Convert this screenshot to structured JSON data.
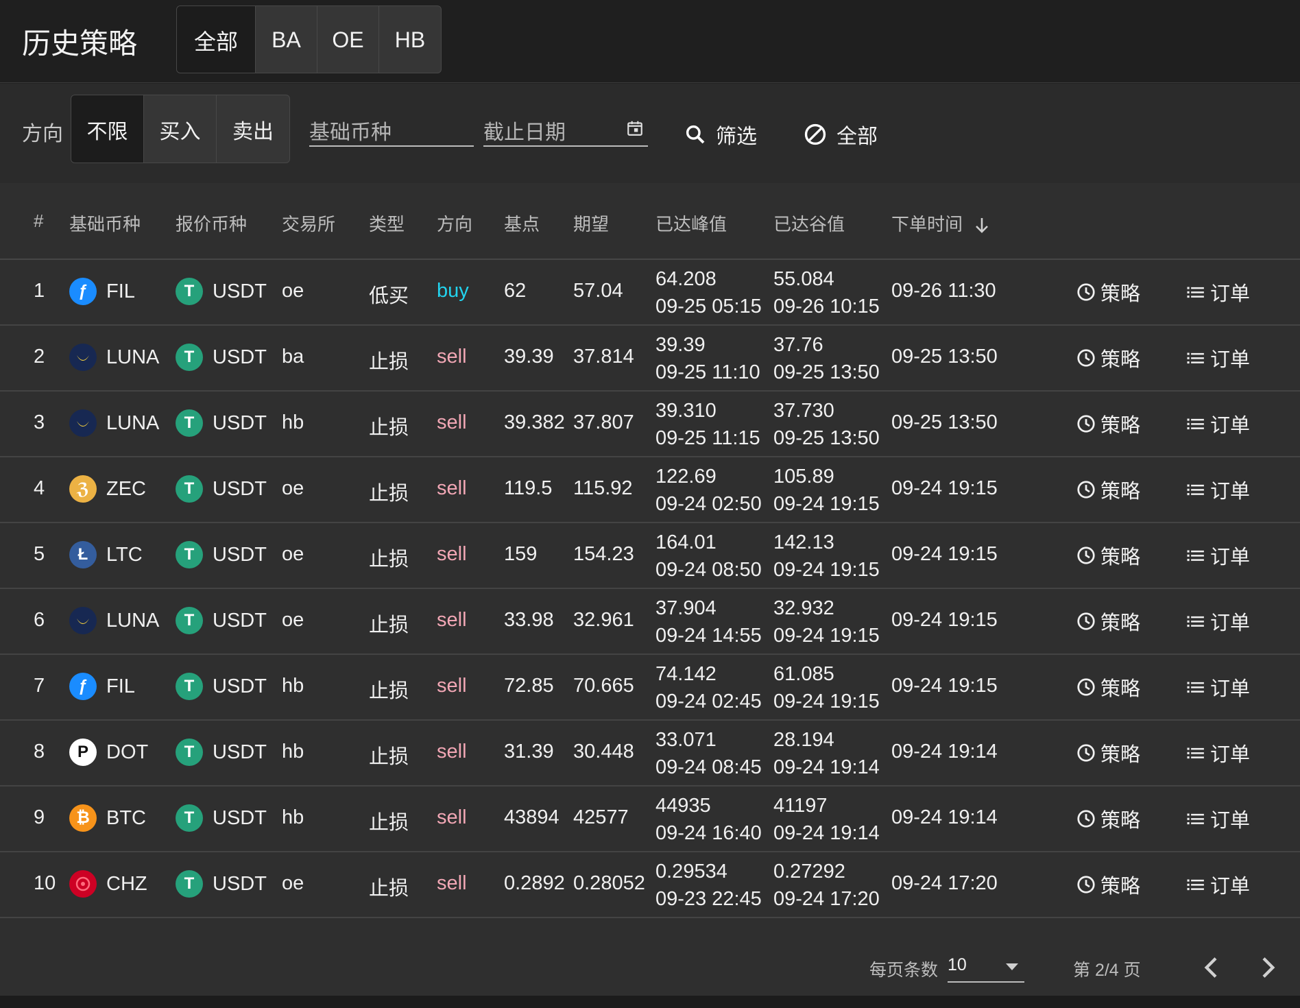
{
  "header": {
    "title": "历史策略",
    "exchange_tabs": [
      "全部",
      "BA",
      "OE",
      "HB"
    ],
    "active_exchange": "全部"
  },
  "filters": {
    "direction_label": "方向",
    "direction_options": [
      "不限",
      "买入",
      "卖出"
    ],
    "active_direction": "不限",
    "base_coin_placeholder": "基础币种",
    "deadline_placeholder": "截止日期",
    "filter_button": "筛选",
    "clear_button": "全部"
  },
  "table": {
    "columns": [
      "#",
      "基础币种",
      "报价币种",
      "交易所",
      "类型",
      "方向",
      "基点",
      "期望",
      "已达峰值",
      "已达谷值",
      "下单时间"
    ],
    "sort_column": "下单时间",
    "sort_direction": "desc",
    "strategy_label": "策略",
    "order_label": "订单",
    "rows": [
      {
        "idx": "1",
        "base": "FIL",
        "quote": "USDT",
        "exchange": "oe",
        "type": "低买",
        "direction": "buy",
        "base_point": "62",
        "expected": "57.04",
        "peak": "64.208",
        "peak_time": "09-25 05:15",
        "trough": "55.084",
        "trough_time": "09-26 10:15",
        "order_time": "09-26 11:30"
      },
      {
        "idx": "2",
        "base": "LUNA",
        "quote": "USDT",
        "exchange": "ba",
        "type": "止损",
        "direction": "sell",
        "base_point": "39.39",
        "expected": "37.814",
        "peak": "39.39",
        "peak_time": "09-25 11:10",
        "trough": "37.76",
        "trough_time": "09-25 13:50",
        "order_time": "09-25 13:50"
      },
      {
        "idx": "3",
        "base": "LUNA",
        "quote": "USDT",
        "exchange": "hb",
        "type": "止损",
        "direction": "sell",
        "base_point": "39.382",
        "expected": "37.807",
        "peak": "39.310",
        "peak_time": "09-25 11:15",
        "trough": "37.730",
        "trough_time": "09-25 13:50",
        "order_time": "09-25 13:50"
      },
      {
        "idx": "4",
        "base": "ZEC",
        "quote": "USDT",
        "exchange": "oe",
        "type": "止损",
        "direction": "sell",
        "base_point": "119.5",
        "expected": "115.92",
        "peak": "122.69",
        "peak_time": "09-24 02:50",
        "trough": "105.89",
        "trough_time": "09-24 19:15",
        "order_time": "09-24 19:15"
      },
      {
        "idx": "5",
        "base": "LTC",
        "quote": "USDT",
        "exchange": "oe",
        "type": "止损",
        "direction": "sell",
        "base_point": "159",
        "expected": "154.23",
        "peak": "164.01",
        "peak_time": "09-24 08:50",
        "trough": "142.13",
        "trough_time": "09-24 19:15",
        "order_time": "09-24 19:15"
      },
      {
        "idx": "6",
        "base": "LUNA",
        "quote": "USDT",
        "exchange": "oe",
        "type": "止损",
        "direction": "sell",
        "base_point": "33.98",
        "expected": "32.961",
        "peak": "37.904",
        "peak_time": "09-24 14:55",
        "trough": "32.932",
        "trough_time": "09-24 19:15",
        "order_time": "09-24 19:15"
      },
      {
        "idx": "7",
        "base": "FIL",
        "quote": "USDT",
        "exchange": "hb",
        "type": "止损",
        "direction": "sell",
        "base_point": "72.85",
        "expected": "70.665",
        "peak": "74.142",
        "peak_time": "09-24 02:45",
        "trough": "61.085",
        "trough_time": "09-24 19:15",
        "order_time": "09-24 19:15"
      },
      {
        "idx": "8",
        "base": "DOT",
        "quote": "USDT",
        "exchange": "hb",
        "type": "止损",
        "direction": "sell",
        "base_point": "31.39",
        "expected": "30.448",
        "peak": "33.071",
        "peak_time": "09-24 08:45",
        "trough": "28.194",
        "trough_time": "09-24 19:14",
        "order_time": "09-24 19:14"
      },
      {
        "idx": "9",
        "base": "BTC",
        "quote": "USDT",
        "exchange": "hb",
        "type": "止损",
        "direction": "sell",
        "base_point": "43894",
        "expected": "42577",
        "peak": "44935",
        "peak_time": "09-24 16:40",
        "trough": "41197",
        "trough_time": "09-24 19:14",
        "order_time": "09-24 19:14"
      },
      {
        "idx": "10",
        "base": "CHZ",
        "quote": "USDT",
        "exchange": "oe",
        "type": "止损",
        "direction": "sell",
        "base_point": "0.2892",
        "expected": "0.28052",
        "peak": "0.29534",
        "peak_time": "09-23 22:45",
        "trough": "0.27292",
        "trough_time": "09-24 17:20",
        "order_time": "09-24 17:20"
      }
    ]
  },
  "coin_icons": {
    "FIL": {
      "icon": "filecoin-icon",
      "glyph": "ƒ",
      "bg": "#1a8cff",
      "fg": "#ffffff"
    },
    "LUNA": {
      "icon": "terra-luna-icon",
      "glyph": "",
      "bg": "#172852",
      "fg": "#ffd83d"
    },
    "ZEC": {
      "icon": "zcash-icon",
      "glyph": "ℨ",
      "bg": "#ecb244",
      "fg": "#ffffff"
    },
    "LTC": {
      "icon": "litecoin-icon",
      "glyph": "Ł",
      "bg": "#345d9d",
      "fg": "#ffffff"
    },
    "DOT": {
      "icon": "polkadot-icon",
      "glyph": "P",
      "bg": "#ffffff",
      "fg": "#111111"
    },
    "BTC": {
      "icon": "bitcoin-icon",
      "glyph": "₿",
      "bg": "#f7931a",
      "fg": "#ffffff"
    },
    "CHZ": {
      "icon": "chiliz-icon",
      "glyph": "",
      "bg": "#cd0124",
      "fg": "#ff6b7d"
    },
    "USDT": {
      "icon": "tether-icon",
      "glyph": "T",
      "bg": "#26a17b",
      "fg": "#ffffff"
    }
  },
  "pagination": {
    "page_size_label": "每页条数",
    "page_size": "10",
    "page_info": "第 2/4 页"
  },
  "colors": {
    "buy": "#22d3ee",
    "sell": "#f2a7b5",
    "background": "#232323"
  }
}
